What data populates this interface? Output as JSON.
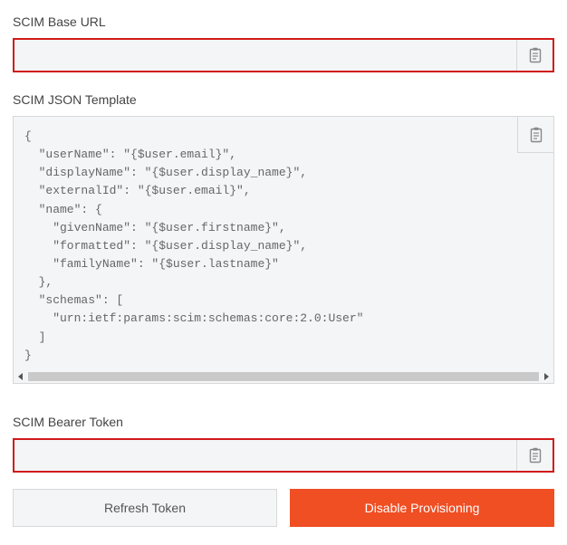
{
  "scim_base_url": {
    "label": "SCIM Base URL",
    "value": ""
  },
  "scim_json_template": {
    "label": "SCIM JSON Template",
    "content": "{\n  \"userName\": \"{$user.email}\",\n  \"displayName\": \"{$user.display_name}\",\n  \"externalId\": \"{$user.email}\",\n  \"name\": {\n    \"givenName\": \"{$user.firstname}\",\n    \"formatted\": \"{$user.display_name}\",\n    \"familyName\": \"{$user.lastname}\"\n  },\n  \"schemas\": [\n    \"urn:ietf:params:scim:schemas:core:2.0:User\"\n  ]\n}"
  },
  "scim_bearer_token": {
    "label": "SCIM Bearer Token",
    "value": ""
  },
  "buttons": {
    "refresh": "Refresh Token",
    "disable": "Disable Provisioning"
  }
}
